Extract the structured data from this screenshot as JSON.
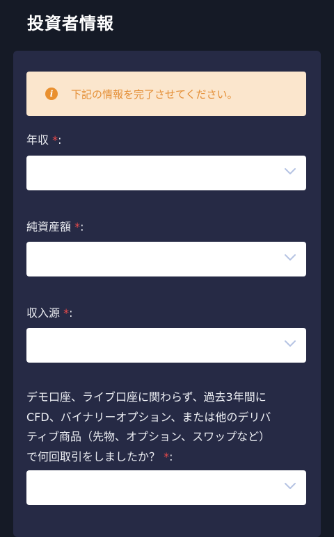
{
  "page": {
    "title": "投資者情報"
  },
  "alert": {
    "icon": "info-icon",
    "message": "下記の情報を完了させてください。"
  },
  "form": {
    "required_mark": "*",
    "fields": [
      {
        "label": "年収",
        "value": ""
      },
      {
        "label": "純資産額",
        "value": ""
      },
      {
        "label": "収入源",
        "value": ""
      },
      {
        "label_lines": [
          "デモ口座、ライブ口座に関わらず、過去3年間に",
          "CFD、バイナリーオプション、または他のデリバ",
          "ティブ商品（先物、オプション、スワップなど）",
          "で何回取引をしましたか？"
        ],
        "value": ""
      }
    ]
  },
  "colors": {
    "background": "#151a26",
    "card": "#262a45",
    "alert_bg": "#fbe6cd",
    "alert_accent": "#e9902f",
    "required": "#e84a4a",
    "chevron": "#b5c3e3"
  }
}
